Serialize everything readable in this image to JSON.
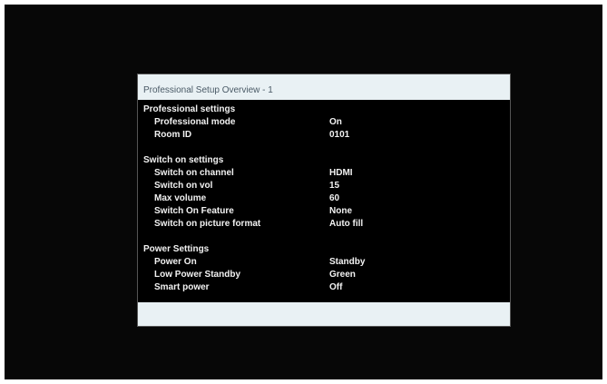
{
  "menu": {
    "title": "Professional Setup Overview - 1",
    "sections": [
      {
        "title": "Professional settings",
        "items": [
          {
            "label": "Professional mode",
            "value": "On"
          },
          {
            "label": "Room ID",
            "value": "0101"
          }
        ]
      },
      {
        "title": "Switch on settings",
        "items": [
          {
            "label": "Switch on channel",
            "value": "HDMI"
          },
          {
            "label": "Switch on vol",
            "value": "15"
          },
          {
            "label": "Max volume",
            "value": "60"
          },
          {
            "label": "Switch On Feature",
            "value": "None"
          },
          {
            "label": "Switch on picture format",
            "value": "Auto fill"
          }
        ]
      },
      {
        "title": "Power Settings",
        "items": [
          {
            "label": "Power On",
            "value": "Standby"
          },
          {
            "label": "Low Power Standby",
            "value": "Green"
          },
          {
            "label": "Smart power",
            "value": "Off"
          }
        ]
      }
    ]
  },
  "colors": {
    "panel_bar": "#e9f1f4",
    "screen_bg": "#070707",
    "text": "#f2f2f2"
  }
}
